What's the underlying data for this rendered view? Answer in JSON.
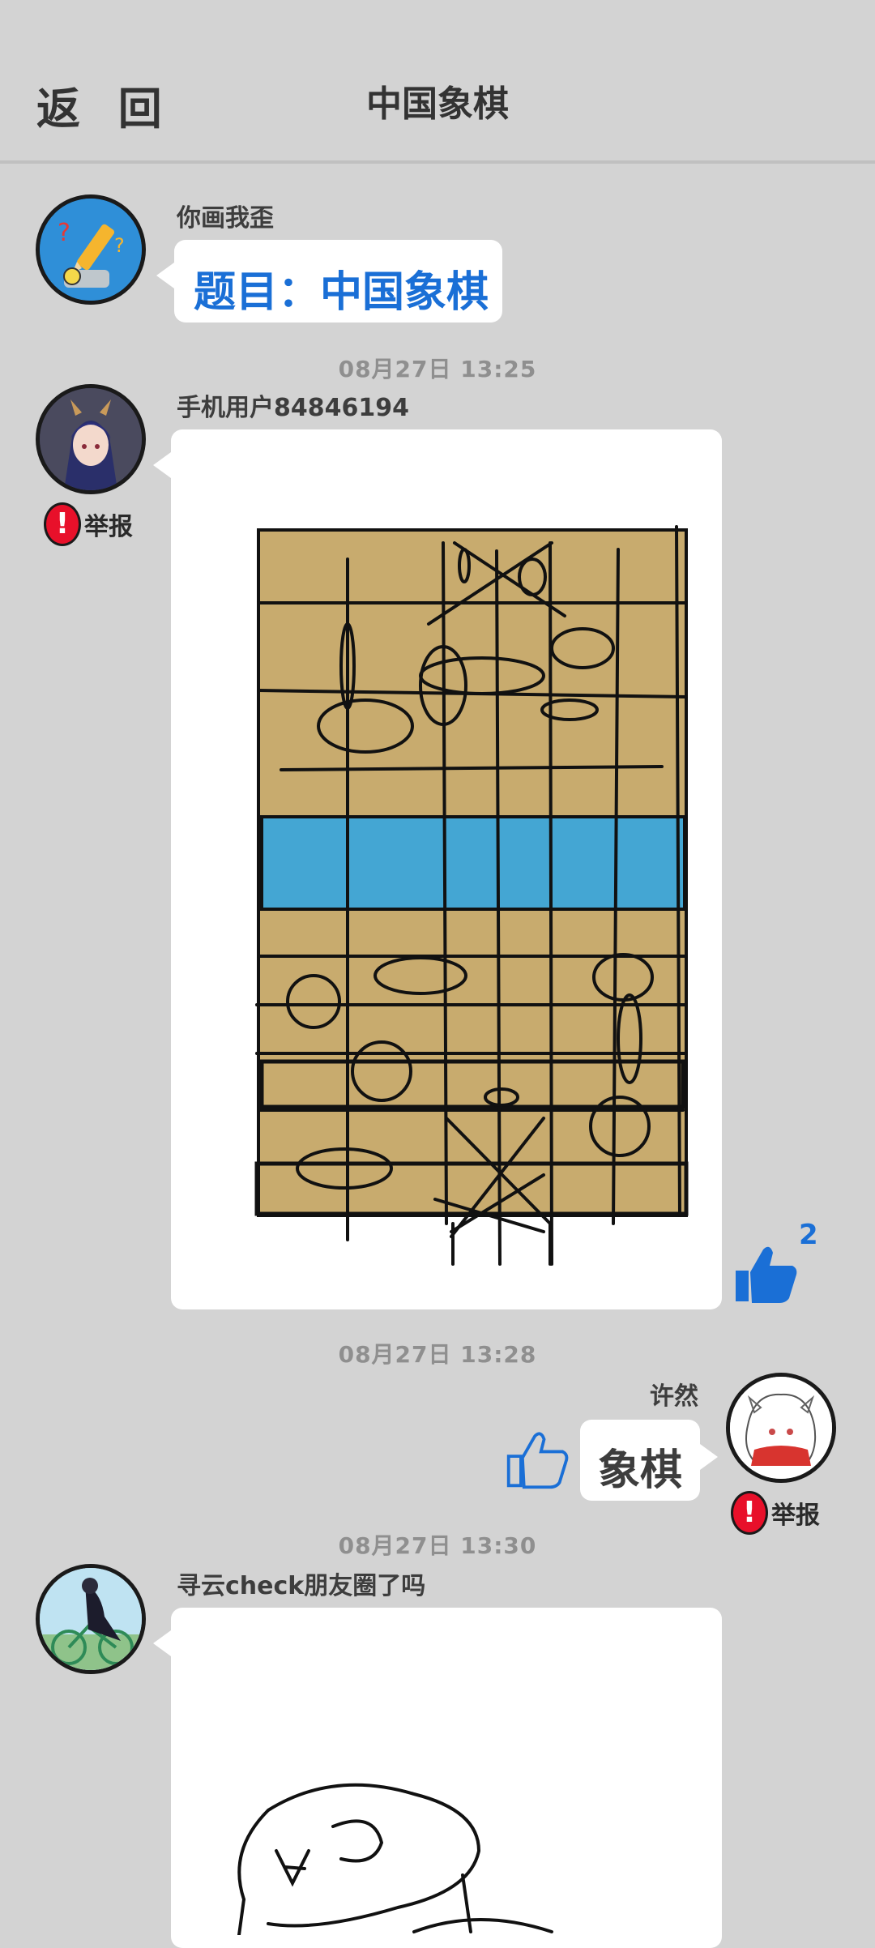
{
  "header": {
    "back_label": "返 回",
    "title": "中国象棋"
  },
  "messages": {
    "m1": {
      "sender": "你画我歪",
      "text": "题目：中国象棋"
    },
    "m2": {
      "time": "08月27日  13:25",
      "sender": "手机用户84846194",
      "report_label": "举报",
      "like_count": "2"
    },
    "m3": {
      "time": "08月27日  13:28",
      "sender": "许然",
      "text": "象棋",
      "report_label": "举报"
    },
    "m4": {
      "time": "08月27日  13:30",
      "sender": "寻云check朋友圈了吗"
    }
  },
  "colors": {
    "accent": "#1a6fd6",
    "board": "#c8ab6e",
    "river": "#44a6d3",
    "report": "#e8102a"
  }
}
